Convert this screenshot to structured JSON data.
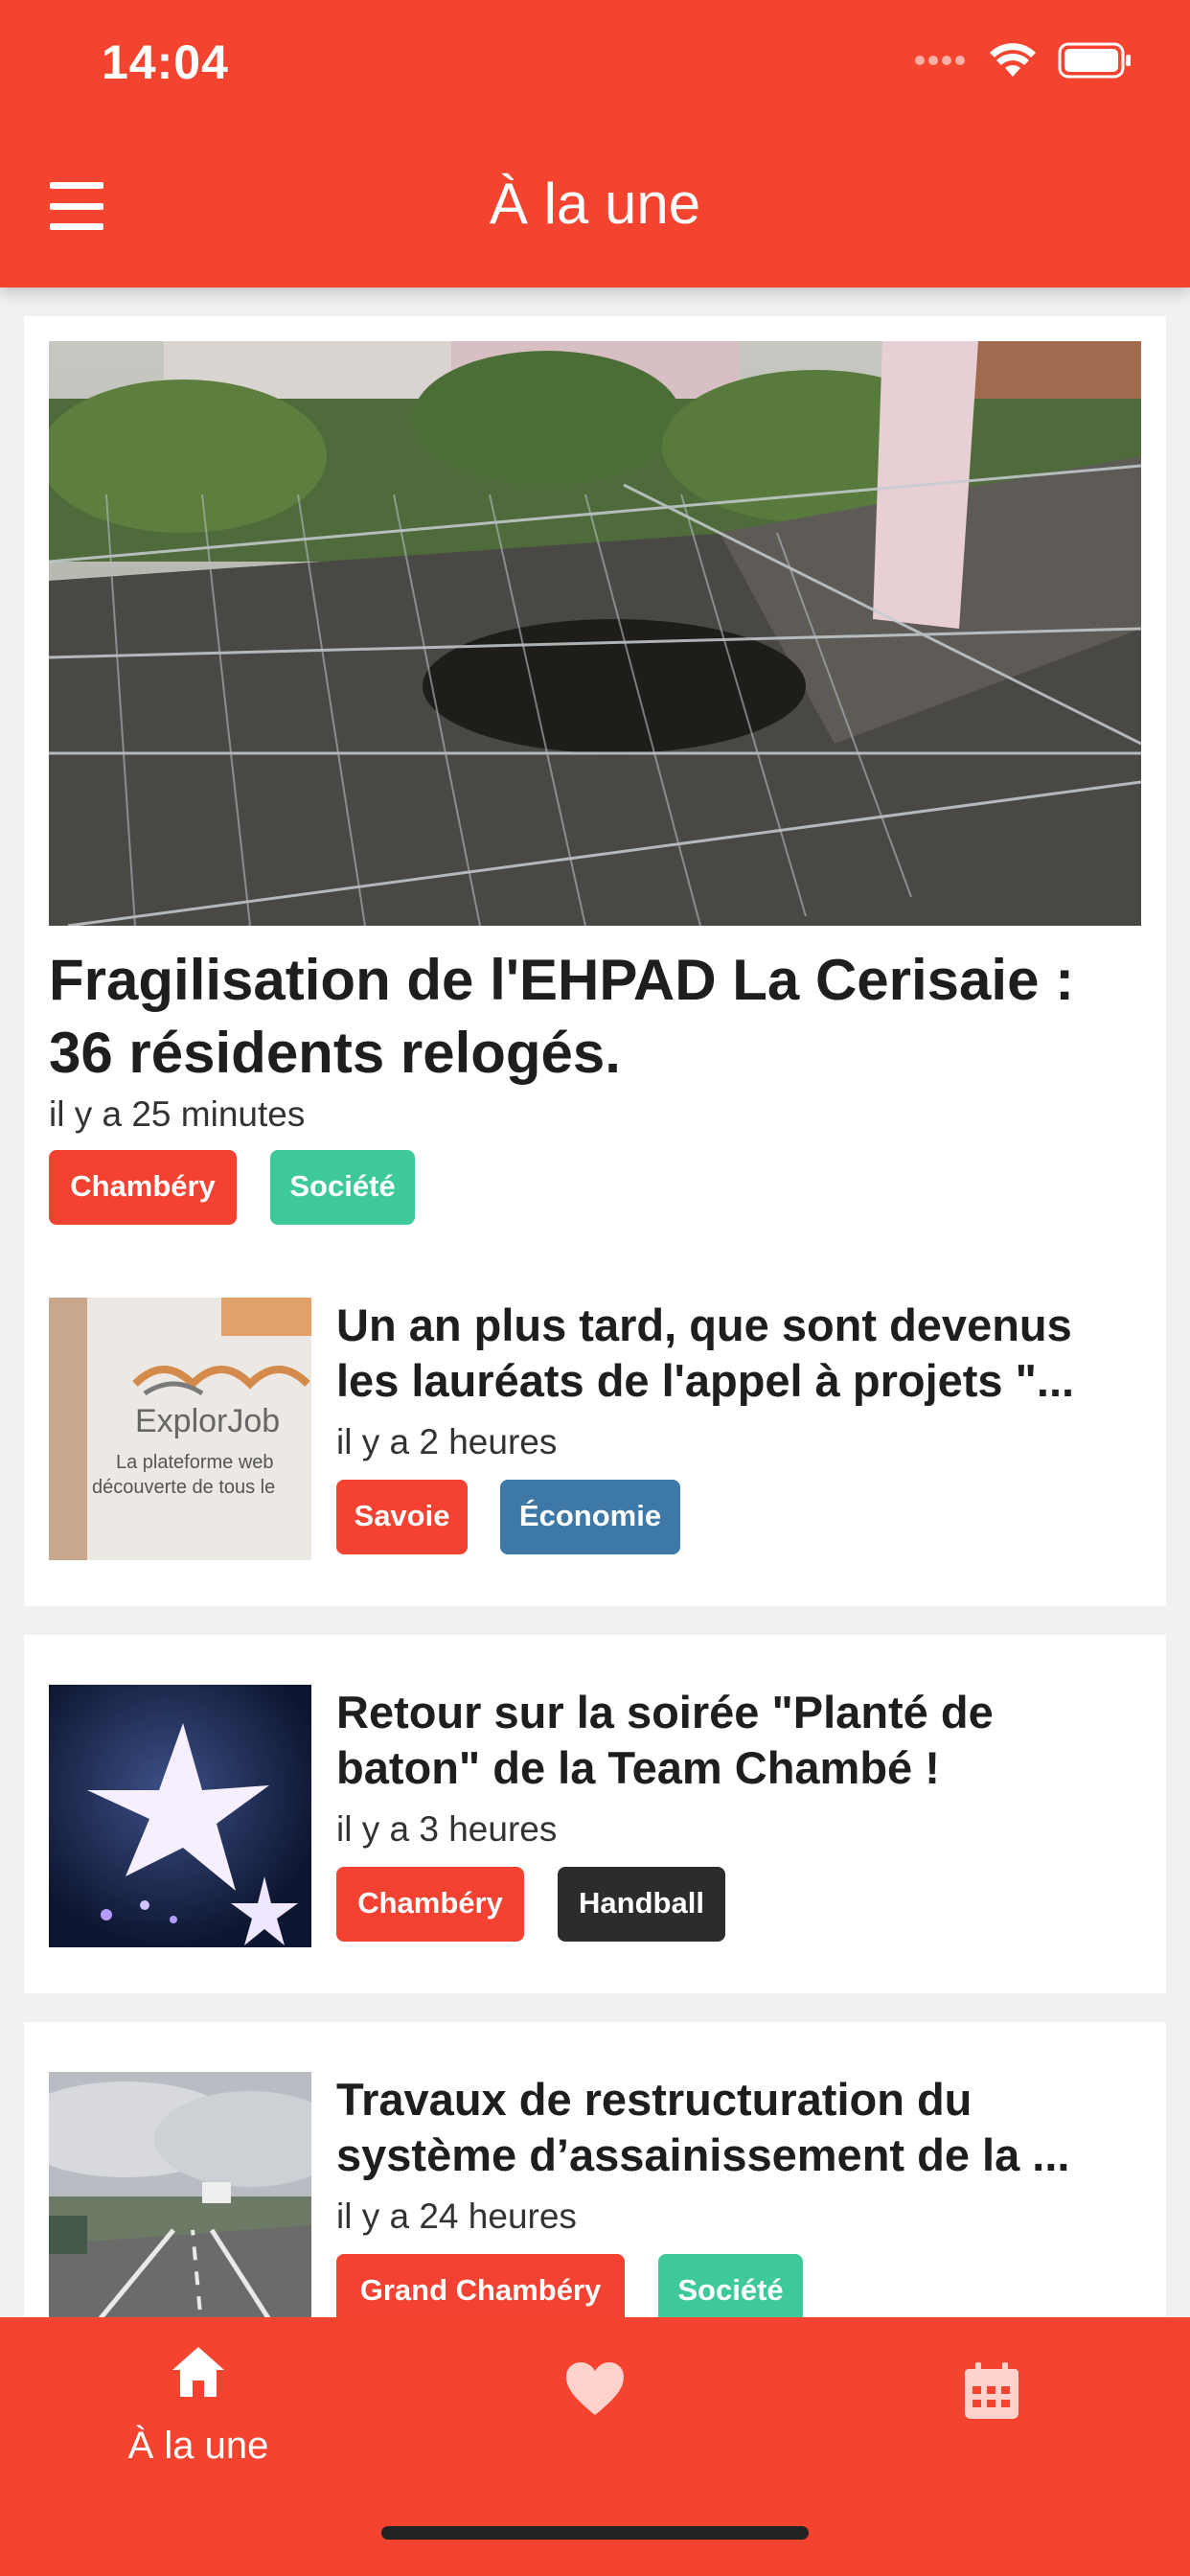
{
  "status_bar": {
    "time": "14:04",
    "icons": [
      "signal-icon",
      "wifi-icon",
      "battery-icon"
    ]
  },
  "header": {
    "title": "À la une",
    "menu_icon": "hamburger-icon"
  },
  "colors": {
    "brand_red": "#f4432e",
    "tag_red": "#f34231",
    "tag_green": "#3ec99a",
    "tag_blue": "#3e78a7",
    "tag_dark": "#2c2c2c"
  },
  "featured": {
    "title": "Fragilisation de l'EHPAD La Cerisaie : 36 résidents relogés.",
    "time": "il y a 25 minutes",
    "tags": [
      "Chambéry",
      "Société"
    ]
  },
  "articles": [
    {
      "title": "Un an plus tard, que sont devenus",
      "title_line2": "les lauréats de l'appel à projets \"...",
      "time": "il y a 2 heures",
      "tags": [
        "Savoie",
        "Économie"
      ],
      "thumb_text": {
        "brand": "ExplorJob",
        "line1": "La plateforme web",
        "line2": "découverte de tous le"
      }
    },
    {
      "title": "Retour sur la soirée \"Planté de",
      "title_line2": "baton\" de la Team Chambé !",
      "time": "il y a 3 heures",
      "tags": [
        "Chambéry",
        "Handball"
      ]
    },
    {
      "title": "Travaux de restructuration du",
      "title_line2": "système d’assainissement de la ...",
      "time": "il y a 24 heures",
      "tags": [
        "Grand Chambéry",
        "Société"
      ]
    }
  ],
  "tabbar": {
    "items": [
      {
        "label": "À la une",
        "icon": "home-icon"
      },
      {
        "label": "",
        "icon": "heart-icon"
      },
      {
        "label": "",
        "icon": "calendar-icon"
      }
    ]
  }
}
